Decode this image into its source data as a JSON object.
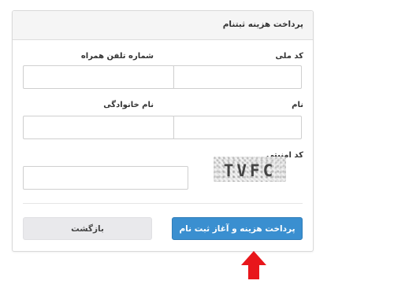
{
  "panel": {
    "title": "پرداخت هزینه ثبتنام"
  },
  "fields": {
    "national_code_label": "کد ملی",
    "mobile_label": "شماره تلفن همراه",
    "first_name_label": "نام",
    "last_name_label": "نام خانوادگی",
    "security_code_label": "کد امنیتی"
  },
  "captcha": {
    "text": "TVFC"
  },
  "buttons": {
    "pay_label": "پرداخت هزینه و آغاز ثبت نام",
    "back_label": "بازگشت"
  },
  "colors": {
    "primary": "#3a8fd0",
    "arrow": "#e8161b"
  },
  "icons": {
    "pointer": "arrow-up-icon"
  }
}
